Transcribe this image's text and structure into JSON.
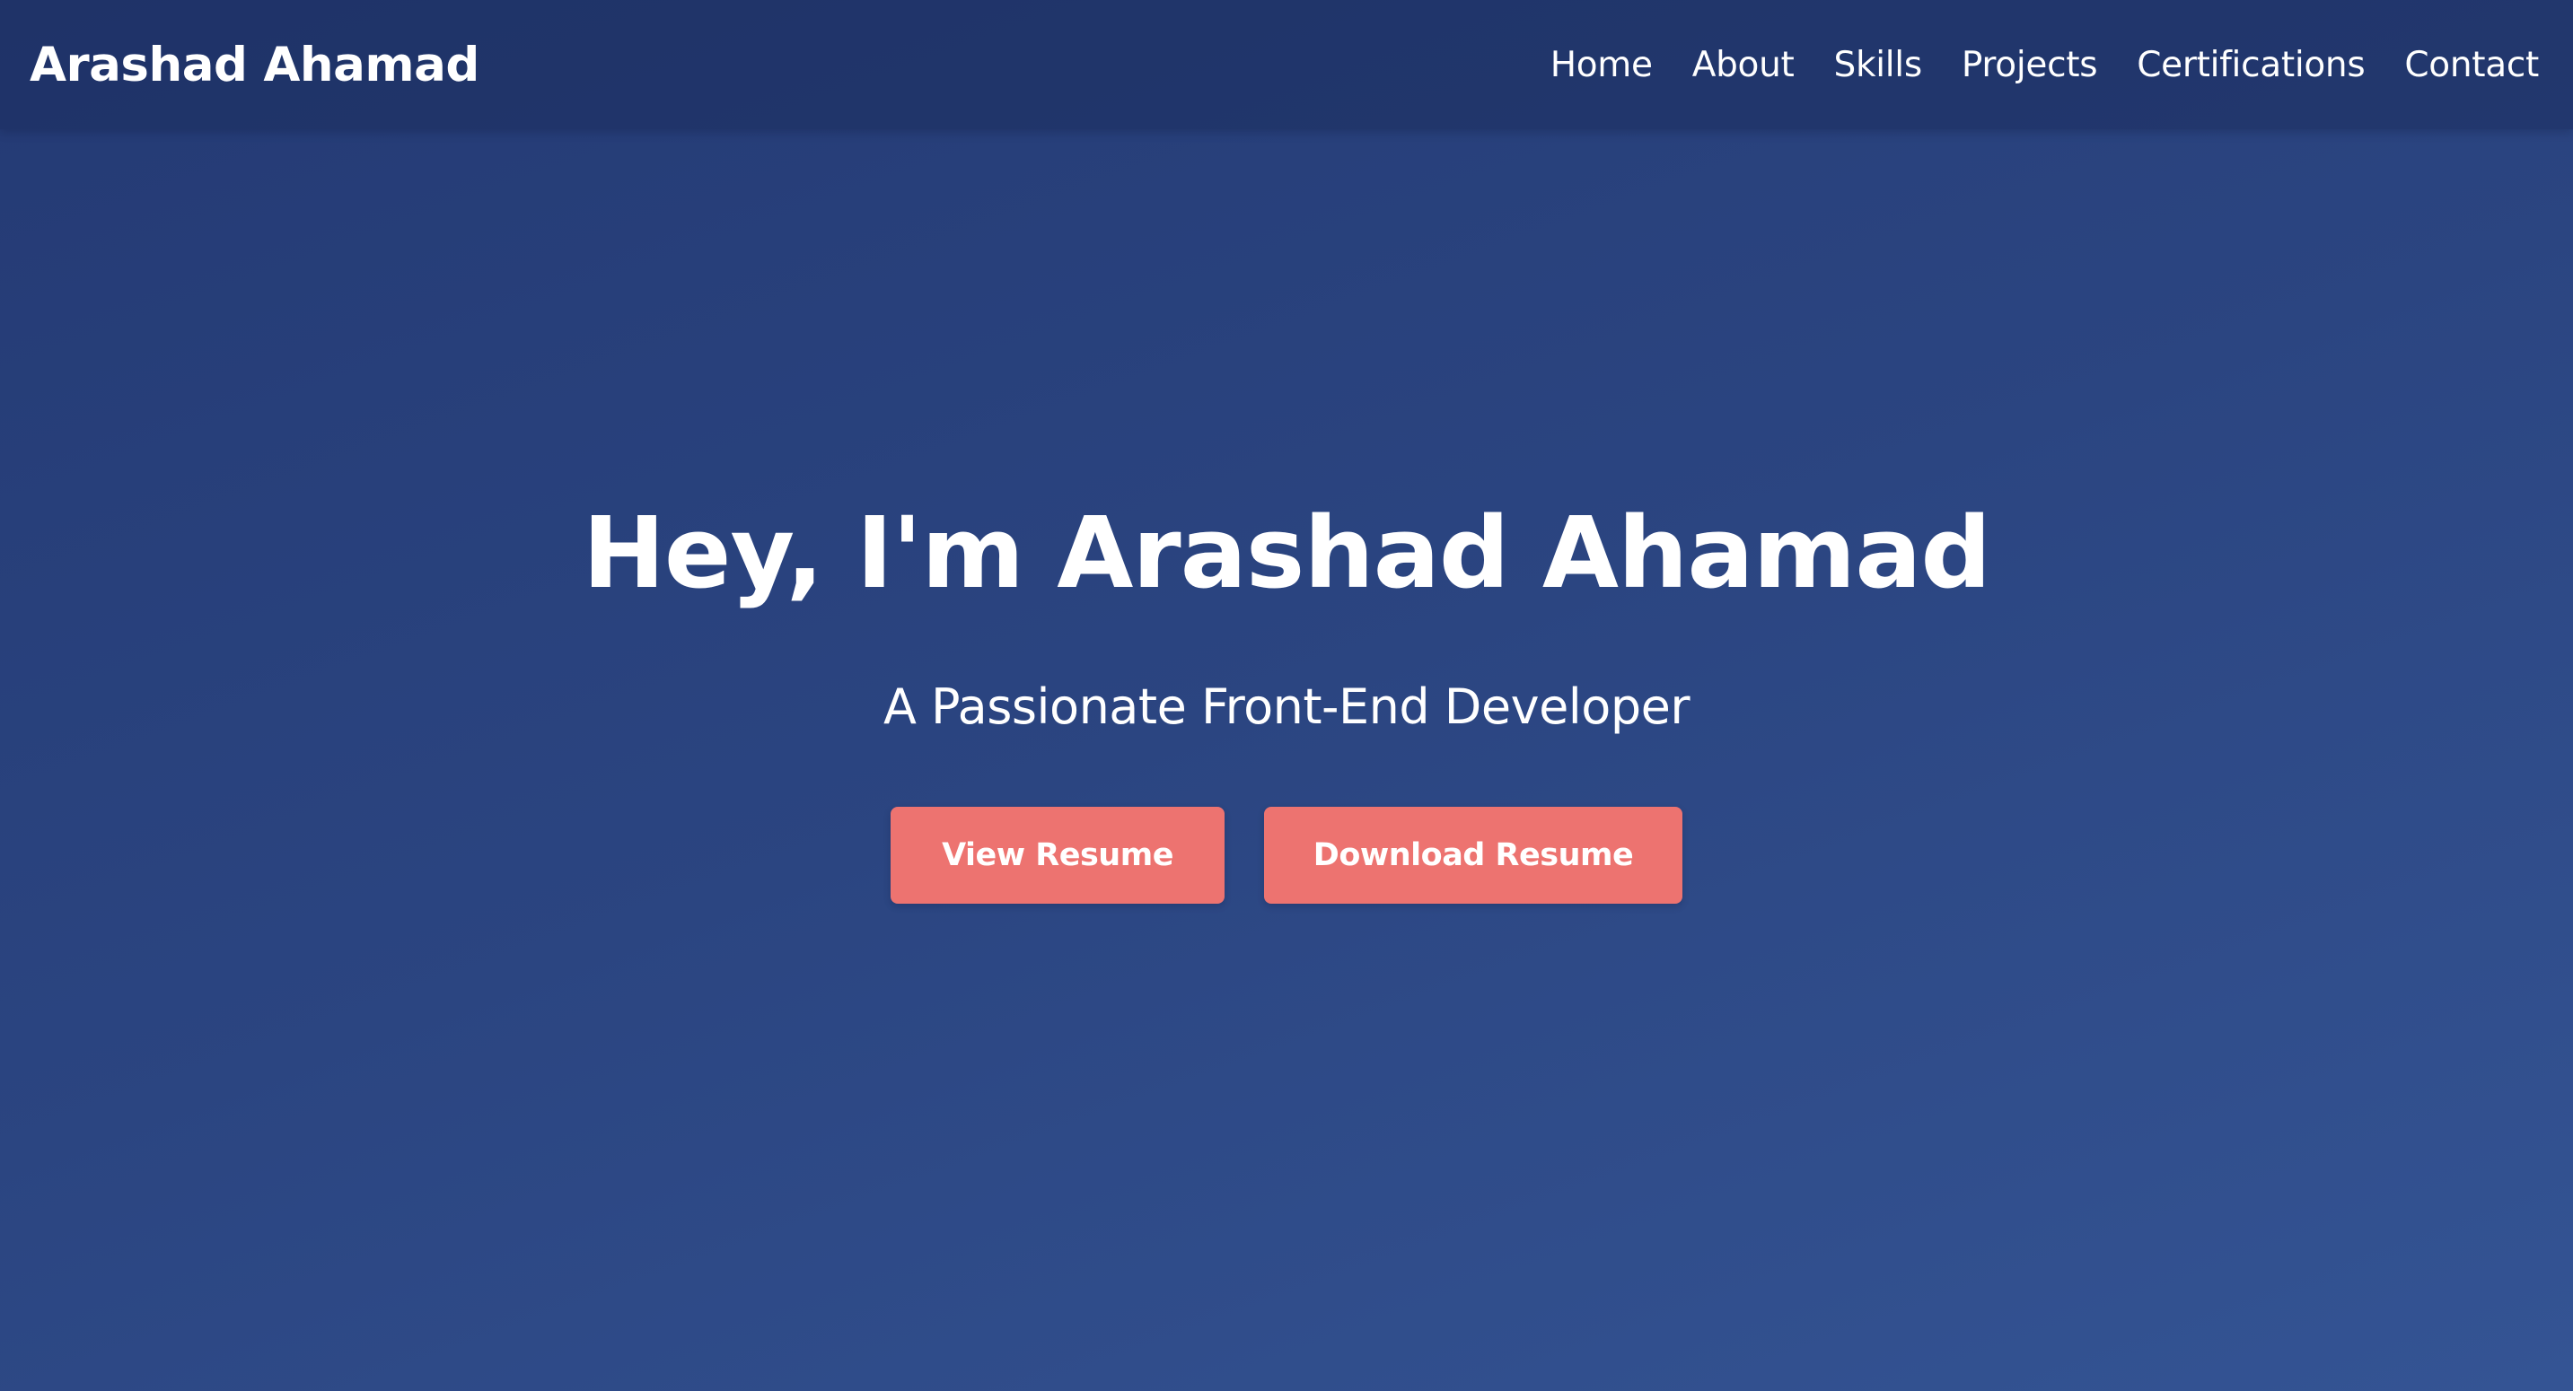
{
  "nav": {
    "brand": "Arashad Ahamad",
    "links": [
      {
        "label": "Home"
      },
      {
        "label": "About"
      },
      {
        "label": "Skills"
      },
      {
        "label": "Projects"
      },
      {
        "label": "Certifications"
      },
      {
        "label": "Contact"
      }
    ]
  },
  "hero": {
    "title": "Hey, I'm Arashad Ahamad",
    "subtitle": "A Passionate Front-End Developer",
    "buttons": {
      "view_resume": "View Resume",
      "download_resume": "Download Resume"
    }
  },
  "colors": {
    "background_start": "#243a74",
    "background_end": "#345494",
    "button": "#ed7370",
    "text": "#ffffff"
  }
}
